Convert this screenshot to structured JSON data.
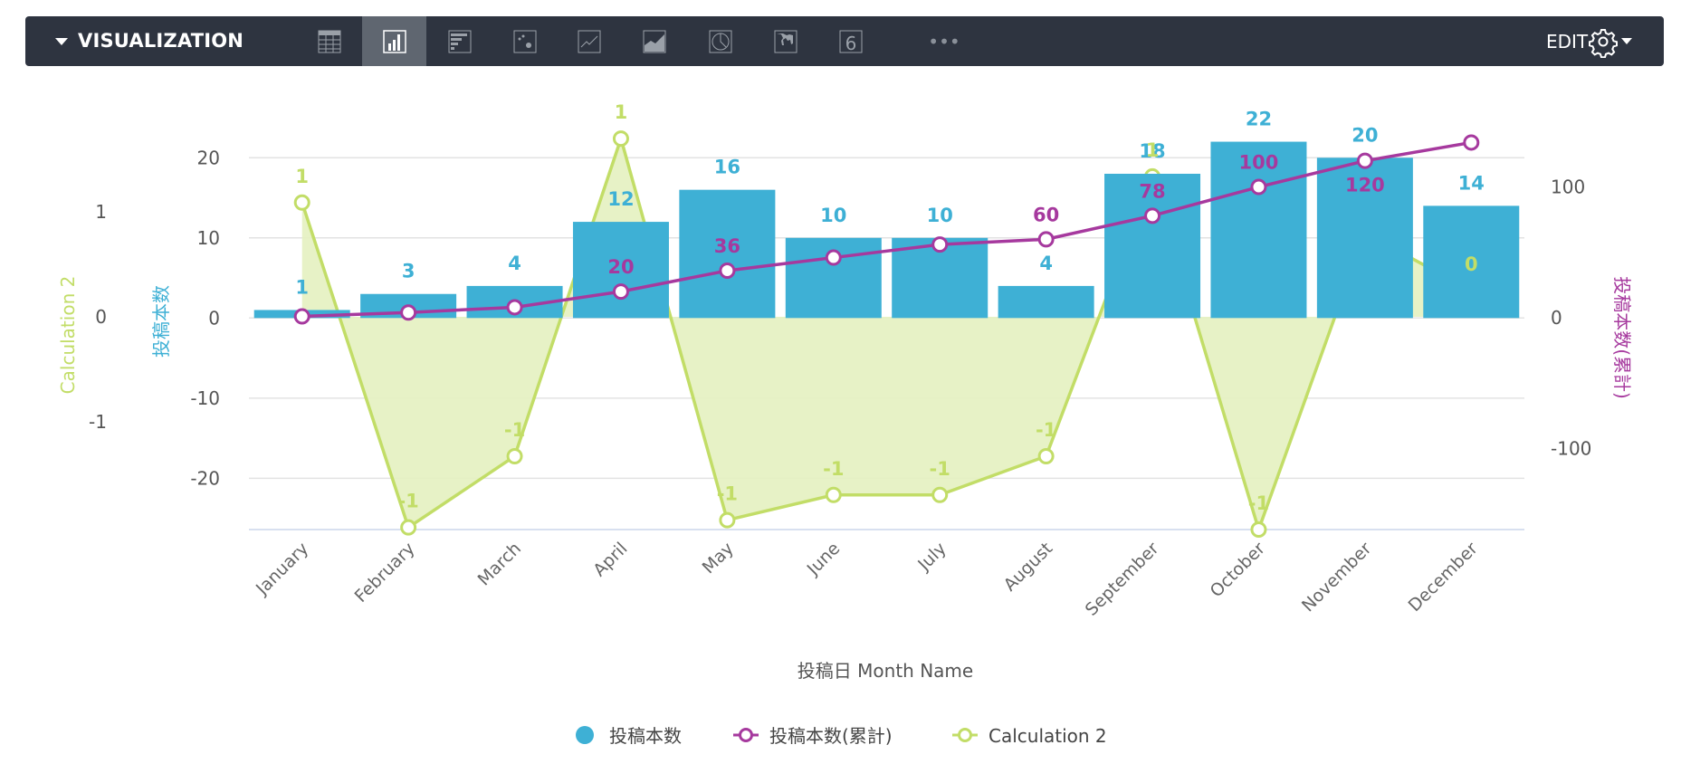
{
  "toolbar": {
    "title": "VISUALIZATION",
    "edit_label": "EDIT",
    "more_label": "•••",
    "vis_types": [
      {
        "icon": "table-icon",
        "selected": false
      },
      {
        "icon": "column-chart-icon",
        "selected": true
      },
      {
        "icon": "bar-chart-icon",
        "selected": false
      },
      {
        "icon": "scatter-chart-icon",
        "selected": false
      },
      {
        "icon": "line-chart-icon",
        "selected": false
      },
      {
        "icon": "area-chart-icon",
        "selected": false
      },
      {
        "icon": "pie-chart-icon",
        "selected": false
      },
      {
        "icon": "map-icon",
        "selected": false
      },
      {
        "icon": "single-value-icon",
        "selected": false,
        "glyph": "6"
      }
    ]
  },
  "colors": {
    "bar": "#3eb0d5",
    "cumulative": "#a6399e",
    "calc": "#c2dd67",
    "calc_fill": "#e4f1c0",
    "axis_text": "#666666",
    "toolbar": "#2e3440"
  },
  "chart_data": {
    "type": "bar",
    "categories": [
      "January",
      "February",
      "March",
      "April",
      "May",
      "June",
      "July",
      "August",
      "September",
      "October",
      "November",
      "December"
    ],
    "xlabel": "投稿日 Month Name",
    "grid": true,
    "legend_placement": "bottom",
    "axes": {
      "left_outer": {
        "title": "Calculation 2",
        "ticks": [
          "1",
          "0",
          "-1"
        ],
        "tick_values": [
          1,
          0,
          -1
        ],
        "ylim": [
          -2.03,
          1.9
        ]
      },
      "left_inner": {
        "title": "投稿本数",
        "ticks": [
          "20",
          "10",
          "0",
          "-10",
          "-20"
        ],
        "tick_values": [
          20,
          10,
          0,
          -10,
          -20
        ],
        "ylim": [
          -26.4,
          25
        ]
      },
      "right": {
        "title": "投稿本数(累計)",
        "ticks": [
          "100",
          "0",
          "-100"
        ],
        "tick_values": [
          100,
          0,
          -100
        ],
        "ylim": [
          -162,
          153
        ]
      }
    },
    "series": [
      {
        "name": "投稿本数",
        "type": "bar",
        "axis": "left_inner",
        "values": [
          1,
          3,
          4,
          12,
          16,
          10,
          10,
          4,
          18,
          22,
          20,
          14
        ],
        "labels": [
          "1",
          "3",
          "4",
          "12",
          "16",
          "10",
          "10",
          "4",
          "18",
          "22",
          "20",
          "14"
        ]
      },
      {
        "name": "投稿本数(累計)",
        "type": "line",
        "axis": "right",
        "values": [
          1,
          4,
          8,
          20,
          36,
          46,
          56,
          60,
          78,
          100,
          120,
          134
        ],
        "labels": [
          "",
          "",
          "",
          "20",
          "36",
          "",
          "",
          "60",
          "78",
          "100",
          "120",
          ""
        ]
      },
      {
        "name": "Calculation 2",
        "type": "area",
        "axis": "left_outer",
        "values": [
          1.09,
          -2.01,
          -1.33,
          1.7,
          -1.94,
          -1.7,
          -1.7,
          -1.33,
          1.34,
          -2.03,
          0.8,
          0.25
        ],
        "labels": [
          "1",
          "-1",
          "-1",
          "1",
          "-1",
          "-1",
          "-1",
          "-1",
          "1",
          "-1",
          "",
          "0"
        ]
      }
    ]
  }
}
